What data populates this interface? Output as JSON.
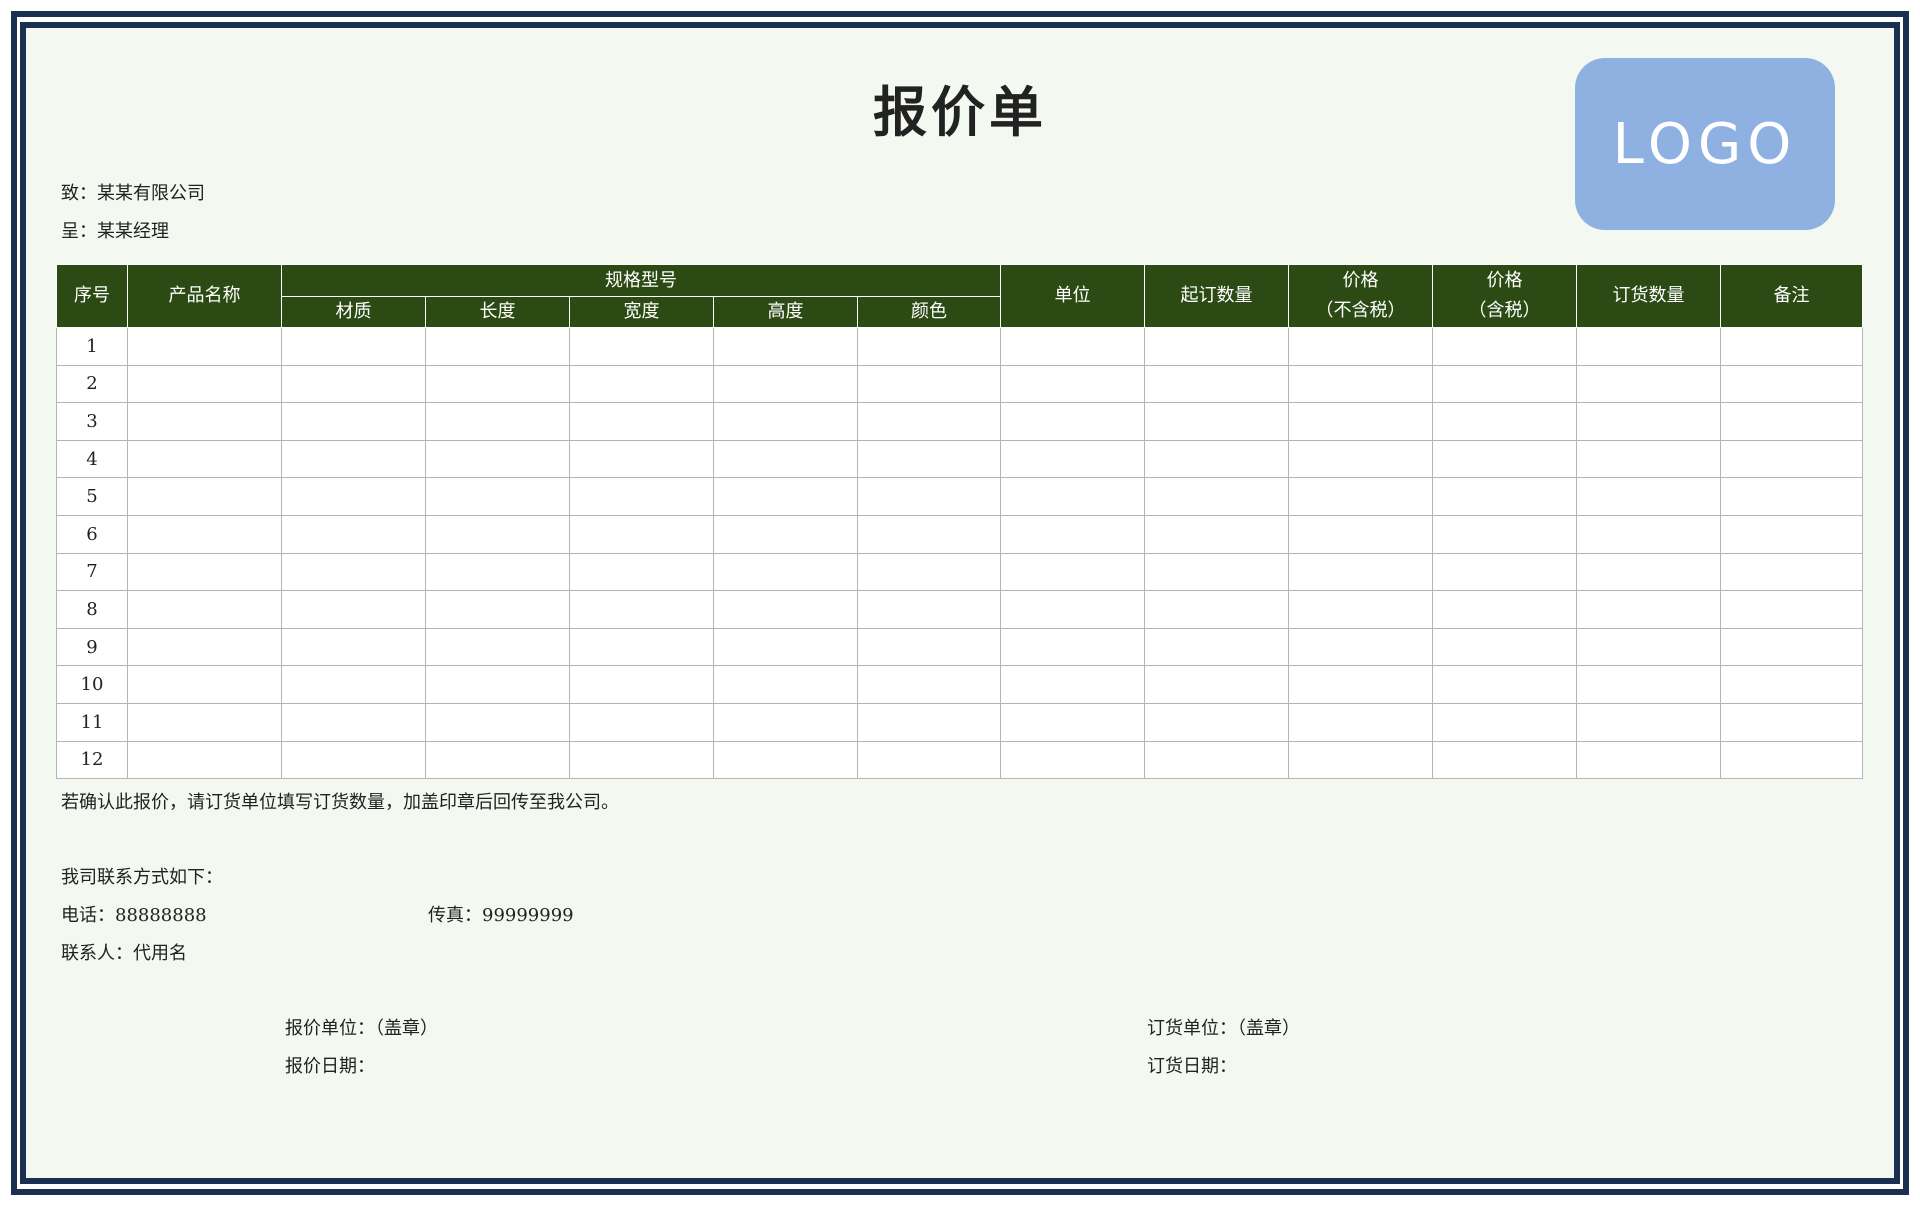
{
  "title": "报价单",
  "logo_text": "LOGO",
  "to_line": "致：某某有限公司",
  "present_line": "呈：某某经理",
  "table": {
    "headers": {
      "no": "序号",
      "product": "产品名称",
      "spec": "规格型号",
      "spec_sub": [
        "材质",
        "长度",
        "宽度",
        "高度",
        "颜色"
      ],
      "unit": "单位",
      "min_qty": "起订数量",
      "price_ex_1": "价格",
      "price_ex_2": "（不含税）",
      "price_inc_1": "价格",
      "price_inc_2": "（含税）",
      "order_qty": "订货数量",
      "remark": "备注"
    },
    "row_numbers": [
      "1",
      "2",
      "3",
      "4",
      "5",
      "6",
      "7",
      "8",
      "9",
      "10",
      "11",
      "12"
    ]
  },
  "confirm_note": "若确认此报价，请订货单位填写订货数量，加盖印章后回传至我公司。",
  "contact": {
    "intro": "我司联系方式如下：",
    "phone": "电话：88888888",
    "fax": "传真：99999999",
    "person": "联系人：代用名"
  },
  "signature": {
    "quote_unit": "报价单位：（盖章）",
    "quote_date": "报价日期：",
    "order_unit": "订货单位：（盖章）",
    "order_date": "订货日期："
  },
  "colors": {
    "frame": "#1a3050",
    "header_bg": "#2b4a14",
    "page_bg": "#f3f8f0",
    "logo_bg": "#8eb1e2"
  }
}
